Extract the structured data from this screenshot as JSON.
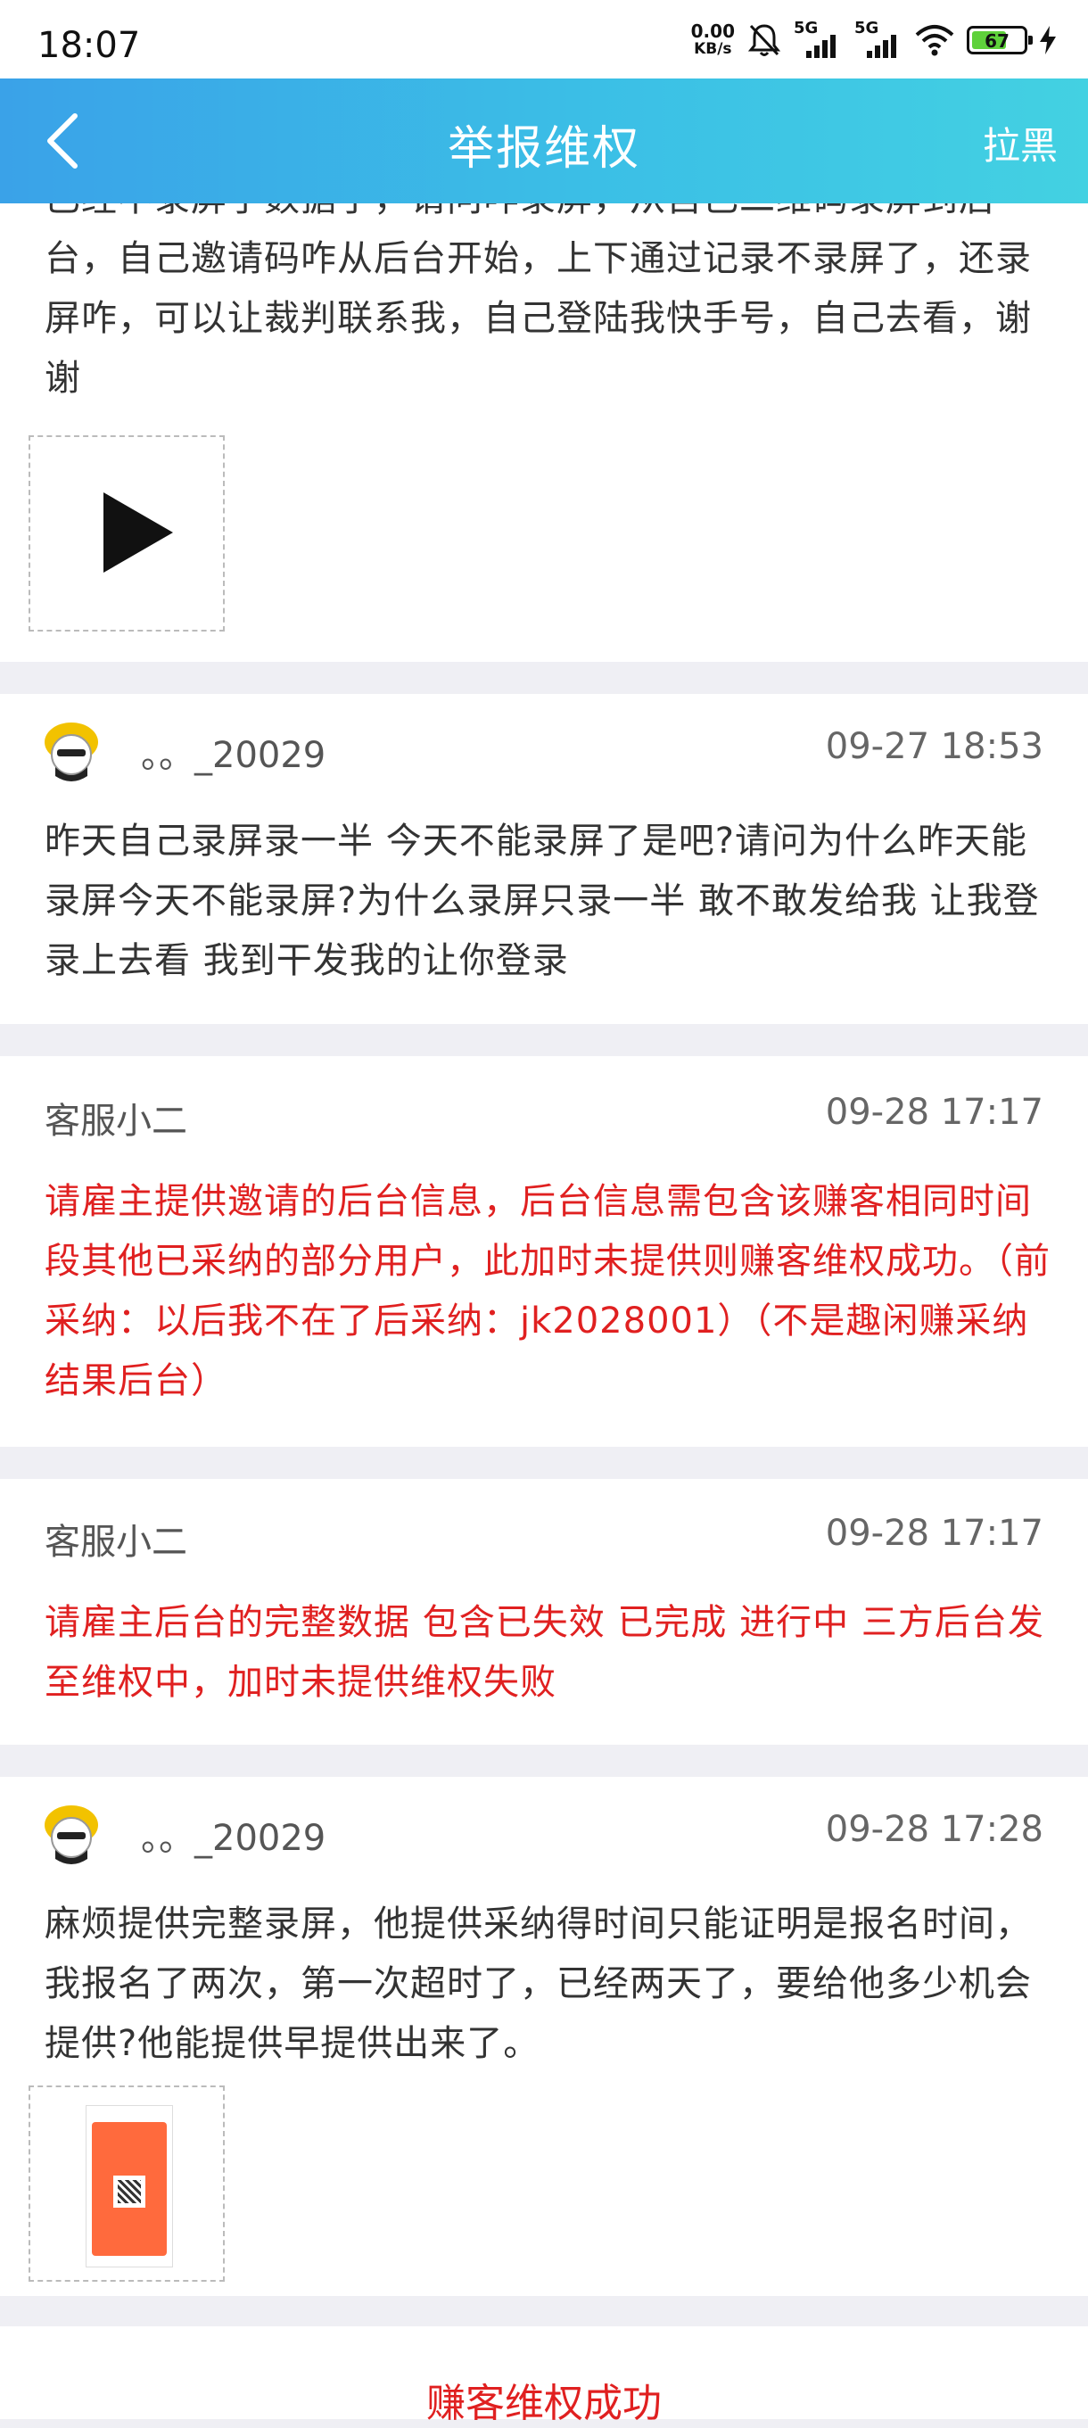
{
  "status_bar": {
    "time": "18:07",
    "network_speed_value": "0.00",
    "network_speed_unit": "KB/s",
    "signal1_label": "5G",
    "signal2_label": "5G",
    "battery_level": "67"
  },
  "nav": {
    "title": "举报维权",
    "right_action": "拉黑"
  },
  "posts": [
    {
      "body": "已经不录屏了数据了，请问咋录屏，从自己二维码录屏到后台，自己邀请码咋从后台开始，上下通过记录不录屏了，还录屏咋，可以让裁判联系我，自己登陆我快手号，自己去看，谢谢",
      "attachment": "video"
    },
    {
      "author": "。。_20029",
      "time": "09-27 18:53",
      "body": "昨天自己录屏录一半 今天不能录屏了是吧?请问为什么昨天能录屏今天不能录屏?为什么录屏只录一半 敢不敢发给我 让我登录上去看 我到干发我的让你登录"
    },
    {
      "author": "客服小二",
      "time": "09-28 17:17",
      "body": "请雇主提供邀请的后台信息，后台信息需包含该赚客相同时间段其他已采纳的部分用户，此加时未提供则赚客维权成功。（前采纳：以后我不在了后采纳：jk2028001）（不是趣闲赚采纳结果后台）"
    },
    {
      "author": "客服小二",
      "time": "09-28 17:17",
      "body": "请雇主后台的完整数据 包含已失效 已完成 进行中 三方后台发至维权中，加时未提供维权失败"
    },
    {
      "author": "。。_20029",
      "time": "09-28 17:28",
      "body": "麻烦提供完整录屏，他提供采纳得时间只能证明是报名时间，我报名了两次，第一次超时了，已经两天了，要给他多少机会提供?他能提供早提供出来了。",
      "attachment": "image"
    }
  ],
  "footer": {
    "result": "赚客维权成功"
  },
  "colors": {
    "accent": "#3aa2e8",
    "service_text": "#e02020"
  }
}
